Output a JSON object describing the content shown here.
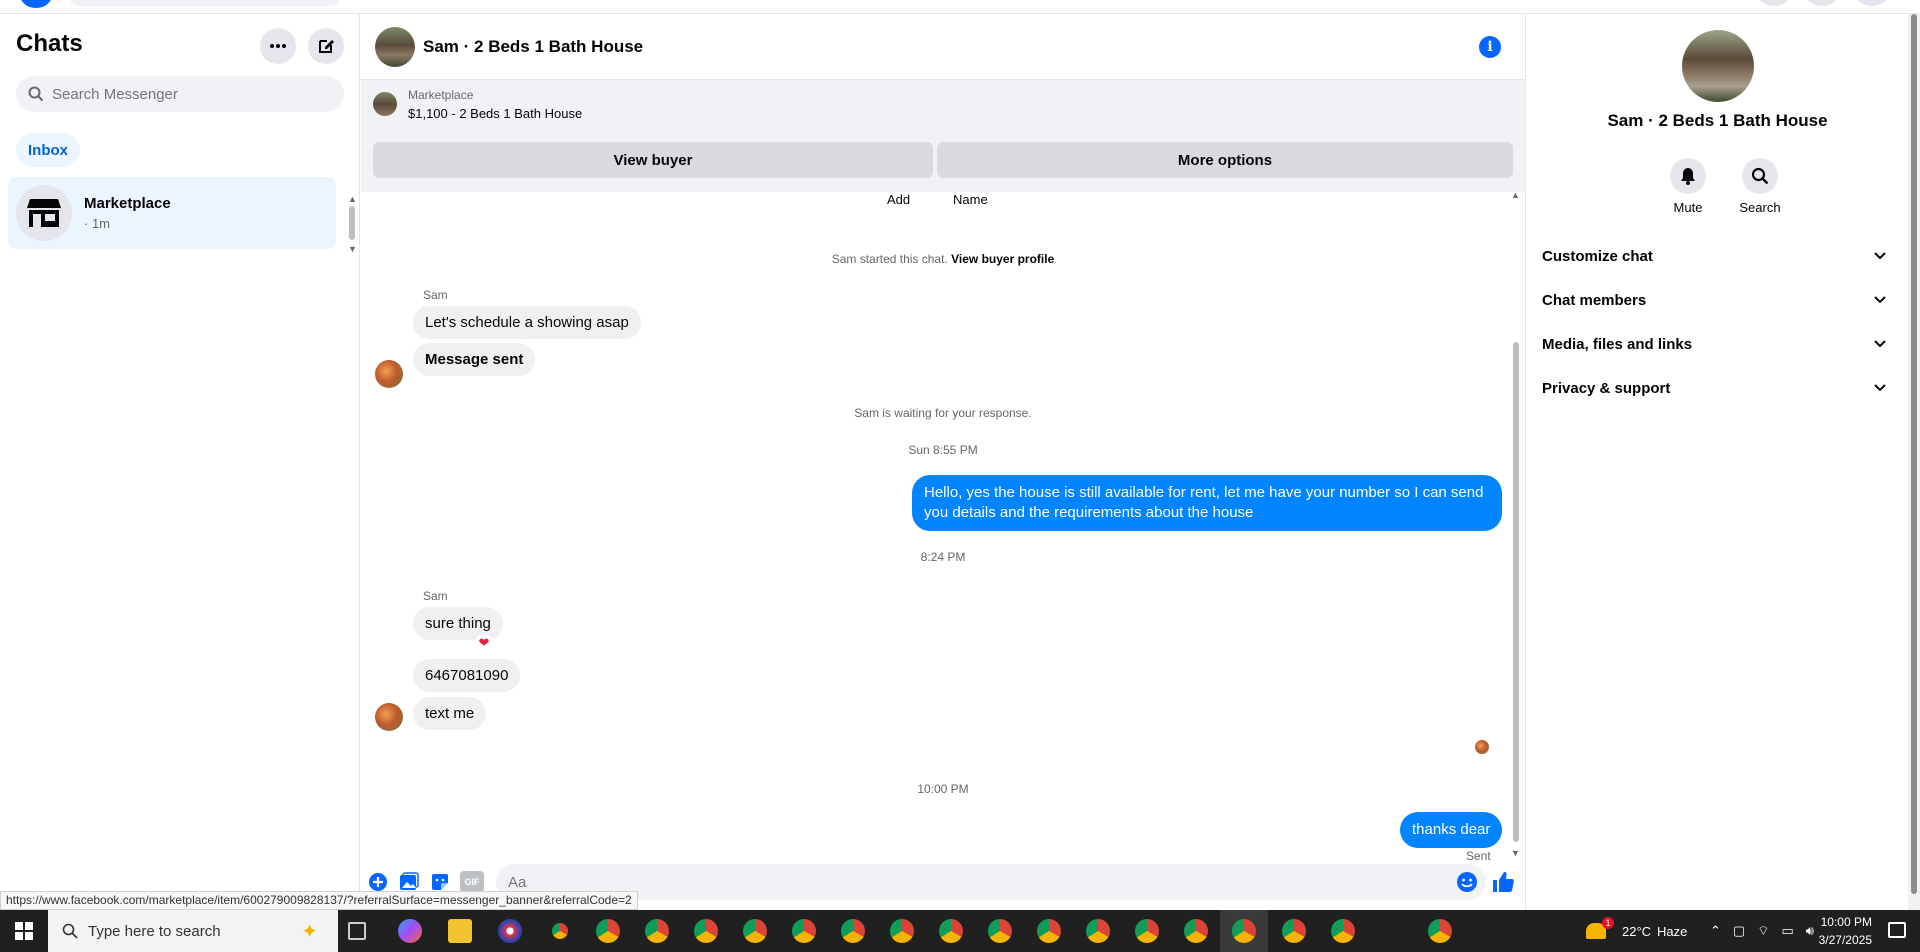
{
  "left_panel": {
    "title": "Chats",
    "search_placeholder": "Search Messenger",
    "filter_label": "Inbox",
    "chat_item": {
      "name": "Marketplace",
      "meta": "· 1m"
    }
  },
  "conversation": {
    "header_title": "Sam · 2 Beds 1 Bath House",
    "banner": {
      "category": "Marketplace",
      "listing": "$1,100 - 2 Beds 1 Bath House",
      "view_buyer": "View buyer",
      "more_options": "More options"
    },
    "partial_top": {
      "add": "Add",
      "name": "Name"
    },
    "started_text": "Sam started this chat.",
    "view_profile_link": "View buyer profile",
    "sender_name": "Sam",
    "msg_1": "Let's schedule a showing asap",
    "msg_2": "Message sent",
    "waiting_text": "Sam is waiting for your response.",
    "time_1": "Sun 8:55 PM",
    "out_msg_1": "Hello, yes the house is still available for rent, let me have your number so I can send you details and the requirements about the house",
    "time_2": "8:24 PM",
    "msg_3": "sure thing",
    "msg_4": "6467081090",
    "msg_5": "text me",
    "time_3": "10:00 PM",
    "out_msg_2": "thanks dear",
    "sent_status": "Sent",
    "composer_placeholder": "Aa",
    "gif_label": "GIF"
  },
  "right_panel": {
    "title": "Sam · 2 Beds 1 Bath House",
    "mute_label": "Mute",
    "search_label": "Search",
    "sections": [
      "Customize chat",
      "Chat members",
      "Media, files and links",
      "Privacy & support"
    ]
  },
  "status_url": "https://www.facebook.com/marketplace/item/600279009828137/?referralSurface=messenger_banner&referralCode=2",
  "taskbar": {
    "search_placeholder": "Type here to search",
    "weather_temp": "22°C",
    "weather_desc": "Haze",
    "time": "10:00 PM",
    "date": "3/27/2025",
    "notification_count": "1"
  },
  "colors": {
    "accent": "#0084ff",
    "brand": "#0866ff",
    "bubble_in": "#f0f0f0"
  }
}
